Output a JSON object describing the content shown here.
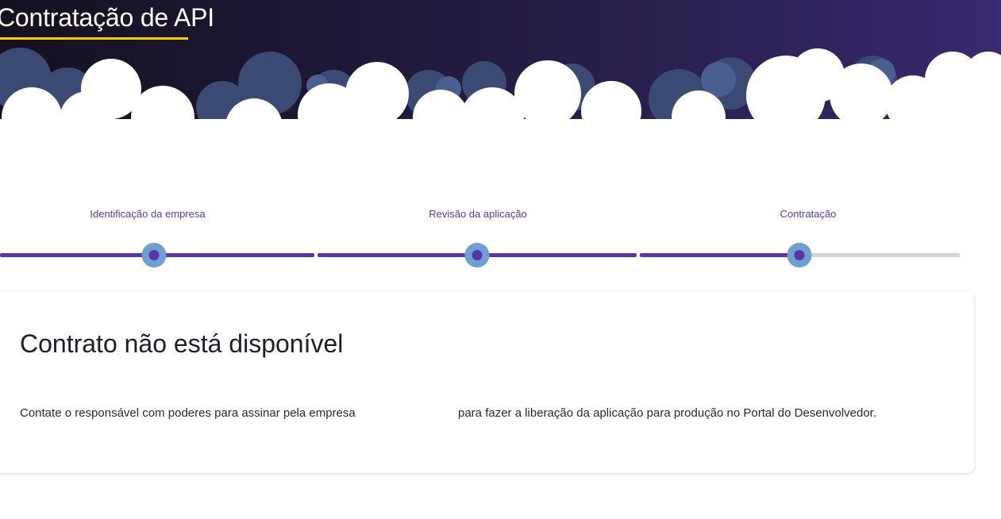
{
  "header": {
    "title": "Contratação de API"
  },
  "stepper": {
    "steps": [
      {
        "label": "Identificação da empresa",
        "status": "complete"
      },
      {
        "label": "Revisão da aplicação",
        "status": "complete"
      },
      {
        "label": "Contratação",
        "status": "current"
      }
    ],
    "colors": {
      "active": "#5b35a6",
      "inactive": "#d4d4d4",
      "dot_ring": "#6f9fd2"
    }
  },
  "notice": {
    "title": "Contrato não está disponível",
    "message_part1": "Contate o responsável com poderes para assinar pela empresa",
    "message_part2": "para fazer a liberação da aplicação para produção no Portal do Desenvolvedor."
  },
  "colors": {
    "accent_underline": "#f3d000",
    "label_text": "#5b3aa8"
  }
}
